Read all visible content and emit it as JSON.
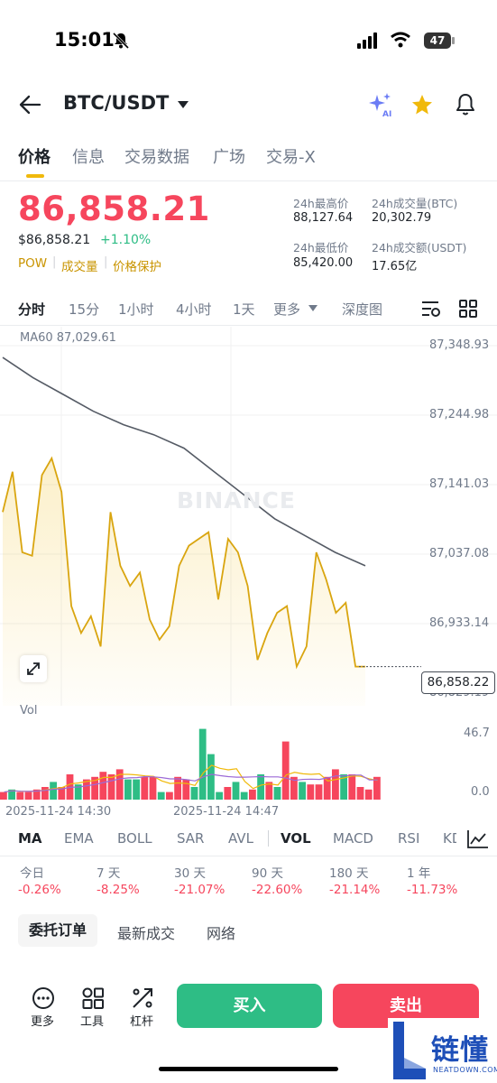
{
  "status_bar": {
    "time": "15:01",
    "battery": "47"
  },
  "header": {
    "title": "BTC/USDT"
  },
  "tabs": [
    {
      "label": "价格"
    },
    {
      "label": "信息"
    },
    {
      "label": "交易数据"
    },
    {
      "label": "广场"
    },
    {
      "label": "交易-X"
    }
  ],
  "price": {
    "last": "86,858.21",
    "usd": "$86,858.21",
    "change": "+1.10%",
    "tags": [
      "POW",
      "成交量",
      "价格保护"
    ]
  },
  "stats": {
    "high_label": "24h最高价",
    "high_value": "88,127.64",
    "vol_btc_label": "24h成交量(BTC)",
    "vol_btc_value": "20,302.79",
    "low_label": "24h最低价",
    "low_value": "85,420.00",
    "vol_usdt_label": "24h成交额(USDT)",
    "vol_usdt_value": "17.65亿"
  },
  "intervals": {
    "items": [
      "分时",
      "15分",
      "1小时",
      "4小时",
      "1天",
      "更多"
    ],
    "depth": "深度图"
  },
  "chart": {
    "ma_label": "MA60 87,029.61",
    "watermark": "BINANCE",
    "y_ticks": [
      "87,348.93",
      "87,244.98",
      "87,141.03",
      "87,037.08",
      "86,933.14",
      "86,829.19"
    ],
    "current_price": "86,858.22",
    "vol_label": "Vol",
    "vol_ticks": [
      "46.7",
      "0.0"
    ],
    "date_labels": [
      "2025-11-24 14:30",
      "2025-11-24 14:47"
    ]
  },
  "chart_data": {
    "type": "line",
    "title": "",
    "ylim": [
      86829.19,
      87348.93
    ],
    "price": [
      87100,
      87160,
      87040,
      87035,
      87155,
      87180,
      87130,
      86960,
      86920,
      86945,
      86900,
      87100,
      87020,
      86990,
      87010,
      86940,
      86910,
      86930,
      87020,
      87050,
      87060,
      87070,
      86970,
      87060,
      87040,
      86990,
      86880,
      86920,
      86950,
      86960,
      86870,
      86900,
      87040,
      87000,
      86950,
      86965,
      86870,
      86870
    ],
    "ma60": [
      87330,
      87300,
      87275,
      87250,
      87230,
      87215,
      87195,
      87160,
      87125,
      87090,
      87065,
      87040,
      87020
    ],
    "volume": [
      {
        "v": 3,
        "c": "r"
      },
      {
        "v": 4,
        "c": "g"
      },
      {
        "v": 3,
        "c": "r"
      },
      {
        "v": 3,
        "c": "r"
      },
      {
        "v": 4,
        "c": "r"
      },
      {
        "v": 5,
        "c": "r"
      },
      {
        "v": 7,
        "c": "g"
      },
      {
        "v": 5,
        "c": "r"
      },
      {
        "v": 10,
        "c": "r"
      },
      {
        "v": 6,
        "c": "g"
      },
      {
        "v": 8,
        "c": "r"
      },
      {
        "v": 9,
        "c": "r"
      },
      {
        "v": 11,
        "c": "r"
      },
      {
        "v": 10,
        "c": "r"
      },
      {
        "v": 12,
        "c": "r"
      },
      {
        "v": 8,
        "c": "g"
      },
      {
        "v": 8,
        "c": "g"
      },
      {
        "v": 9,
        "c": "r"
      },
      {
        "v": 9,
        "c": "r"
      },
      {
        "v": 3,
        "c": "g"
      },
      {
        "v": 3,
        "c": "r"
      },
      {
        "v": 9,
        "c": "r"
      },
      {
        "v": 8,
        "c": "r"
      },
      {
        "v": 5,
        "c": "g"
      },
      {
        "v": 28,
        "c": "g"
      },
      {
        "v": 18,
        "c": "g"
      },
      {
        "v": 3,
        "c": "g"
      },
      {
        "v": 5,
        "c": "r"
      },
      {
        "v": 7,
        "c": "g"
      },
      {
        "v": 3,
        "c": "g"
      },
      {
        "v": 4,
        "c": "r"
      },
      {
        "v": 10,
        "c": "g"
      },
      {
        "v": 7,
        "c": "r"
      },
      {
        "v": 5,
        "c": "g"
      },
      {
        "v": 23,
        "c": "r"
      },
      {
        "v": 9,
        "c": "r"
      },
      {
        "v": 7,
        "c": "g"
      },
      {
        "v": 6,
        "c": "r"
      },
      {
        "v": 6,
        "c": "r"
      },
      {
        "v": 9,
        "c": "r"
      },
      {
        "v": 12,
        "c": "r"
      },
      {
        "v": 10,
        "c": "g"
      },
      {
        "v": 10,
        "c": "r"
      },
      {
        "v": 5,
        "c": "r"
      },
      {
        "v": 4,
        "c": "r"
      },
      {
        "v": 9,
        "c": "r"
      }
    ]
  },
  "indicators": [
    "MA",
    "EMA",
    "BOLL",
    "SAR",
    "AVL",
    "VOL",
    "MACD",
    "RSI",
    "KD"
  ],
  "performance": [
    {
      "label": "今日",
      "value": "-0.26%"
    },
    {
      "label": "7 天",
      "value": "-8.25%"
    },
    {
      "label": "30 天",
      "value": "-21.07%"
    },
    {
      "label": "90 天",
      "value": "-22.60%"
    },
    {
      "label": "180 天",
      "value": "-21.14%"
    },
    {
      "label": "1 年",
      "value": "-11.73%"
    }
  ],
  "order_tabs": [
    "委托订单",
    "最新成交",
    "网络"
  ],
  "bottom_bar": {
    "more": "更多",
    "tools": "工具",
    "leverage": "杠杆",
    "buy": "买入",
    "sell": "卖出"
  },
  "watermark_logo": {
    "cn": "链懂",
    "en": "NEATDOWN.COM"
  },
  "colors": {
    "up": "#2ebd85",
    "down": "#f6465d",
    "accent": "#f0b90b"
  }
}
